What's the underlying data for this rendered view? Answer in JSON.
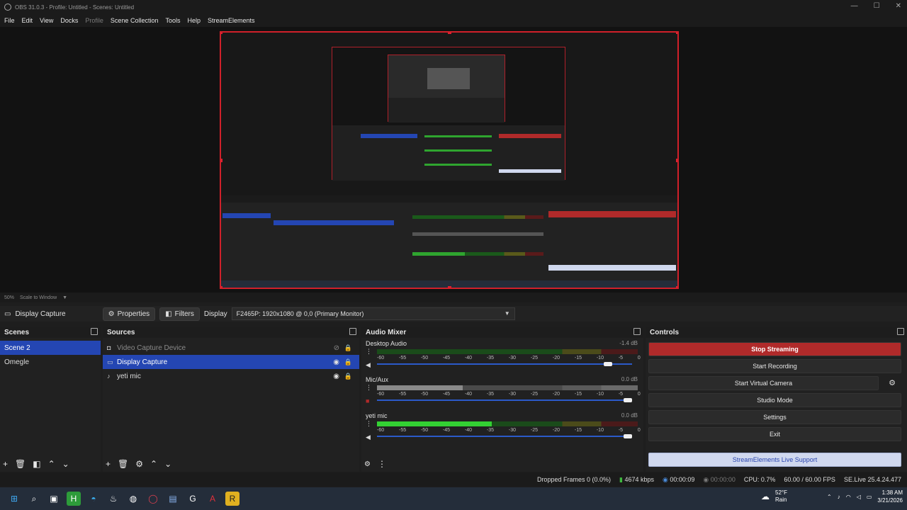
{
  "window": {
    "title": "OBS 31.0.3 - Profile: Untitled - Scenes: Untitled",
    "controls": [
      "—",
      "☐",
      "✕"
    ]
  },
  "menu": {
    "items": [
      "File",
      "Edit",
      "View",
      "Docks",
      "Profile",
      "Scene Collection",
      "Tools",
      "Help",
      "StreamElements"
    ]
  },
  "preview": {
    "zoom": "50%",
    "scale_mode": "Scale to Window"
  },
  "toolbar": {
    "source_name": "Display Capture",
    "properties_label": "Properties",
    "filters_label": "Filters",
    "display_label": "Display",
    "display_value": "F2465P: 1920x1080 @ 0,0 (Primary Monitor)"
  },
  "scenes": {
    "title": "Scenes",
    "items": [
      "Scene 2",
      "Omegle"
    ],
    "selected": 0
  },
  "sources": {
    "title": "Sources",
    "items": [
      {
        "name": "Video Capture Device",
        "icon": "camera-icon",
        "hidden": true
      },
      {
        "name": "Display Capture",
        "icon": "monitor-icon",
        "hidden": false
      },
      {
        "name": "yeti mic",
        "icon": "mic-icon",
        "hidden": false
      }
    ],
    "selected": 1
  },
  "mixer": {
    "title": "Audio Mixer",
    "ticks": [
      "-60",
      "-55",
      "-50",
      "-45",
      "-40",
      "-35",
      "-30",
      "-25",
      "-20",
      "-15",
      "-10",
      "-5",
      "0"
    ],
    "channels": [
      {
        "name": "Desktop Audio",
        "db": "-1.4 dB",
        "level": 0.0,
        "volume": 0.92,
        "muted": false
      },
      {
        "name": "Mic/Aux",
        "db": "0.0 dB",
        "level": 0.33,
        "volume": 1.0,
        "muted": true
      },
      {
        "name": "yeti mic",
        "db": "0.0 dB",
        "level": 0.44,
        "volume": 1.0,
        "muted": false
      }
    ]
  },
  "controls": {
    "title": "Controls",
    "stop_streaming": "Stop Streaming",
    "start_recording": "Start Recording",
    "start_virtual_camera": "Start Virtual Camera",
    "studio_mode": "Studio Mode",
    "settings": "Settings",
    "exit": "Exit",
    "se_support": "StreamElements Live Support"
  },
  "status": {
    "dropped": "Dropped Frames 0 (0.0%)",
    "bitrate": "4674 kbps",
    "stream_time": "00:00:09",
    "rec_time": "00:00:00",
    "cpu": "CPU: 0.7%",
    "fps": "60.00 / 60.00 FPS",
    "se_version": "SE.Live 25.4.24.477"
  },
  "taskbar": {
    "weather_temp": "52°F",
    "weather_desc": "Rain",
    "time": "1:38 AM",
    "date": "3/21/2026"
  },
  "colors": {
    "accent": "#2446b3",
    "stream_red": "#b02a2a",
    "preview_border": "#d0202a"
  }
}
